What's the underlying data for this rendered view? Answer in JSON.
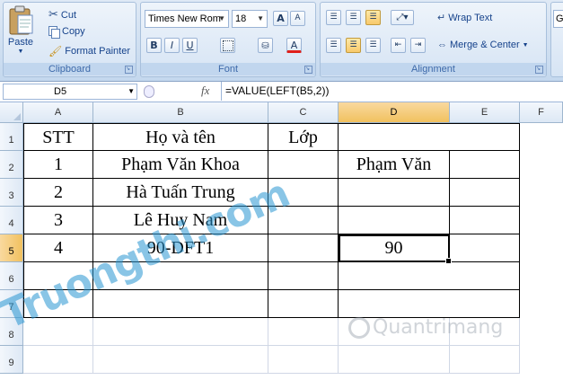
{
  "ribbon": {
    "clipboard": {
      "paste": "Paste",
      "cut": "Cut",
      "copy": "Copy",
      "format_painter": "Format Painter",
      "label": "Clipboard"
    },
    "font": {
      "name": "Times New Rom",
      "size": "18",
      "label": "Font",
      "bold": "B",
      "italic": "I",
      "underline": "U",
      "grow": "A",
      "shrink": "A"
    },
    "alignment": {
      "wrap_text": "Wrap Text",
      "merge_center": "Merge & Center",
      "label": "Alignment"
    },
    "number_format_partial": "G"
  },
  "formula_bar": {
    "name_box": "D5",
    "fx": "fx",
    "formula": "=VALUE(LEFT(B5,2))"
  },
  "columns": [
    "A",
    "B",
    "C",
    "D",
    "E",
    "F"
  ],
  "rows": [
    "1",
    "2",
    "3",
    "4",
    "5",
    "6",
    "7",
    "8",
    "9"
  ],
  "cells": {
    "A1": "STT",
    "B1": "Họ và tên",
    "C1": "Lớp",
    "D1": "",
    "A2": "1",
    "B2": "Phạm Văn Khoa",
    "C2": "",
    "D2": "Phạm Văn",
    "A3": "2",
    "B3": "Hà Tuấn Trung",
    "C3": "",
    "D3": "",
    "A4": "3",
    "B4": "Lê Huy Nam",
    "C4": "",
    "D4": "",
    "A5": "4",
    "B5": "90-DFT1",
    "C5": "",
    "D5": "90"
  },
  "watermarks": {
    "site1": "Truongthi.com",
    "site2": "Quantrimang"
  },
  "colors": {
    "selected_header": "#f1c15f",
    "ribbon": "#c4d8ee"
  }
}
